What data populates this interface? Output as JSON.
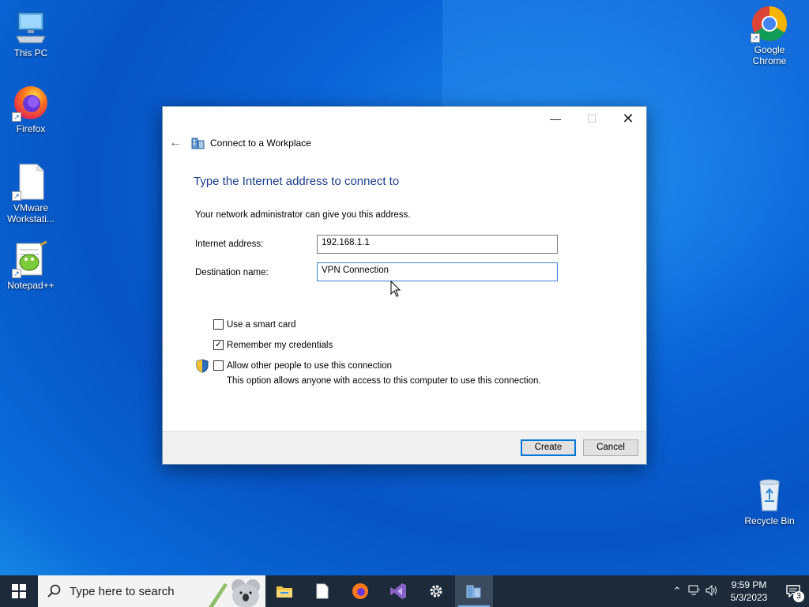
{
  "desktop": {
    "icons": [
      {
        "label": "This PC"
      },
      {
        "label": "Firefox"
      },
      {
        "label": "VMware Workstati..."
      },
      {
        "label": "Notepad++"
      },
      {
        "label": "Google Chrome"
      },
      {
        "label": "Recycle Bin"
      }
    ]
  },
  "dialog": {
    "window_title": "Connect to a Workplace",
    "heading": "Type the Internet address to connect to",
    "info": "Your network administrator can give you this address.",
    "internet_address_label": "Internet address:",
    "internet_address_value": "192.168.1.1",
    "destination_name_label": "Destination name:",
    "destination_name_value": "VPN Connection",
    "smart_card_label": "Use a smart card",
    "smart_card_checked": false,
    "remember_label": "Remember my credentials",
    "remember_checked": true,
    "allow_others_label": "Allow other people to use this connection",
    "allow_others_checked": false,
    "allow_others_note": "This option allows anyone with access to this computer to use this connection.",
    "create_label": "Create",
    "cancel_label": "Cancel"
  },
  "taskbar": {
    "search_placeholder": "Type here to search",
    "time": "9:59 PM",
    "date": "5/3/2023",
    "notification_count": "3"
  },
  "colors": {
    "heading": "#1a3c8c",
    "taskbar": "#1c2a3a",
    "accent": "#0078d7"
  }
}
